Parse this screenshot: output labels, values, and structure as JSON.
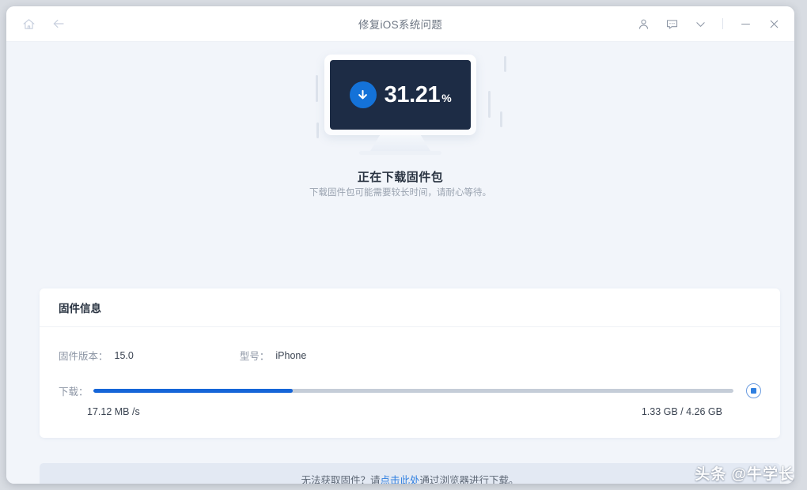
{
  "titlebar": {
    "title": "修复iOS系统问题",
    "home_icon": "home-icon",
    "back_icon": "back-arrow-icon",
    "account_icon": "user-icon",
    "feedback_icon": "chat-icon",
    "more_icon": "chevron-down-icon",
    "minimize_icon": "minimize-icon",
    "close_icon": "close-icon"
  },
  "hero": {
    "percent_value": "31.21",
    "percent_symbol": "%",
    "download_icon": "download-arrow-icon",
    "title": "正在下载固件包",
    "subtitle": "下载固件包可能需要较长时间，请耐心等待。"
  },
  "card": {
    "header": "固件信息",
    "firmware_version_label": "固件版本：",
    "firmware_version_value": "15.0",
    "model_label": "型号：",
    "model_value": "iPhone",
    "download_label": "下载：",
    "speed": "17.12 MB /s",
    "size": "1.33 GB / 4.26 GB",
    "stop_icon": "stop-button-icon"
  },
  "footer": {
    "text_before": "无法获取固件？请",
    "link": "点击此处",
    "text_after": "通过浏览器进行下载。"
  },
  "watermark": {
    "text": "头条 @牛学长"
  },
  "progress": {
    "percent": 31.21,
    "fill_color": "#1565d8",
    "track_color": "#c5cdd8"
  },
  "colors": {
    "page_bg": "#f2f5fa",
    "card_bg": "#ffffff",
    "screen_bg": "#1d2c45",
    "accent": "#1472d8",
    "footer_bg": "#e3e9f3",
    "link": "#2f7fe0"
  }
}
